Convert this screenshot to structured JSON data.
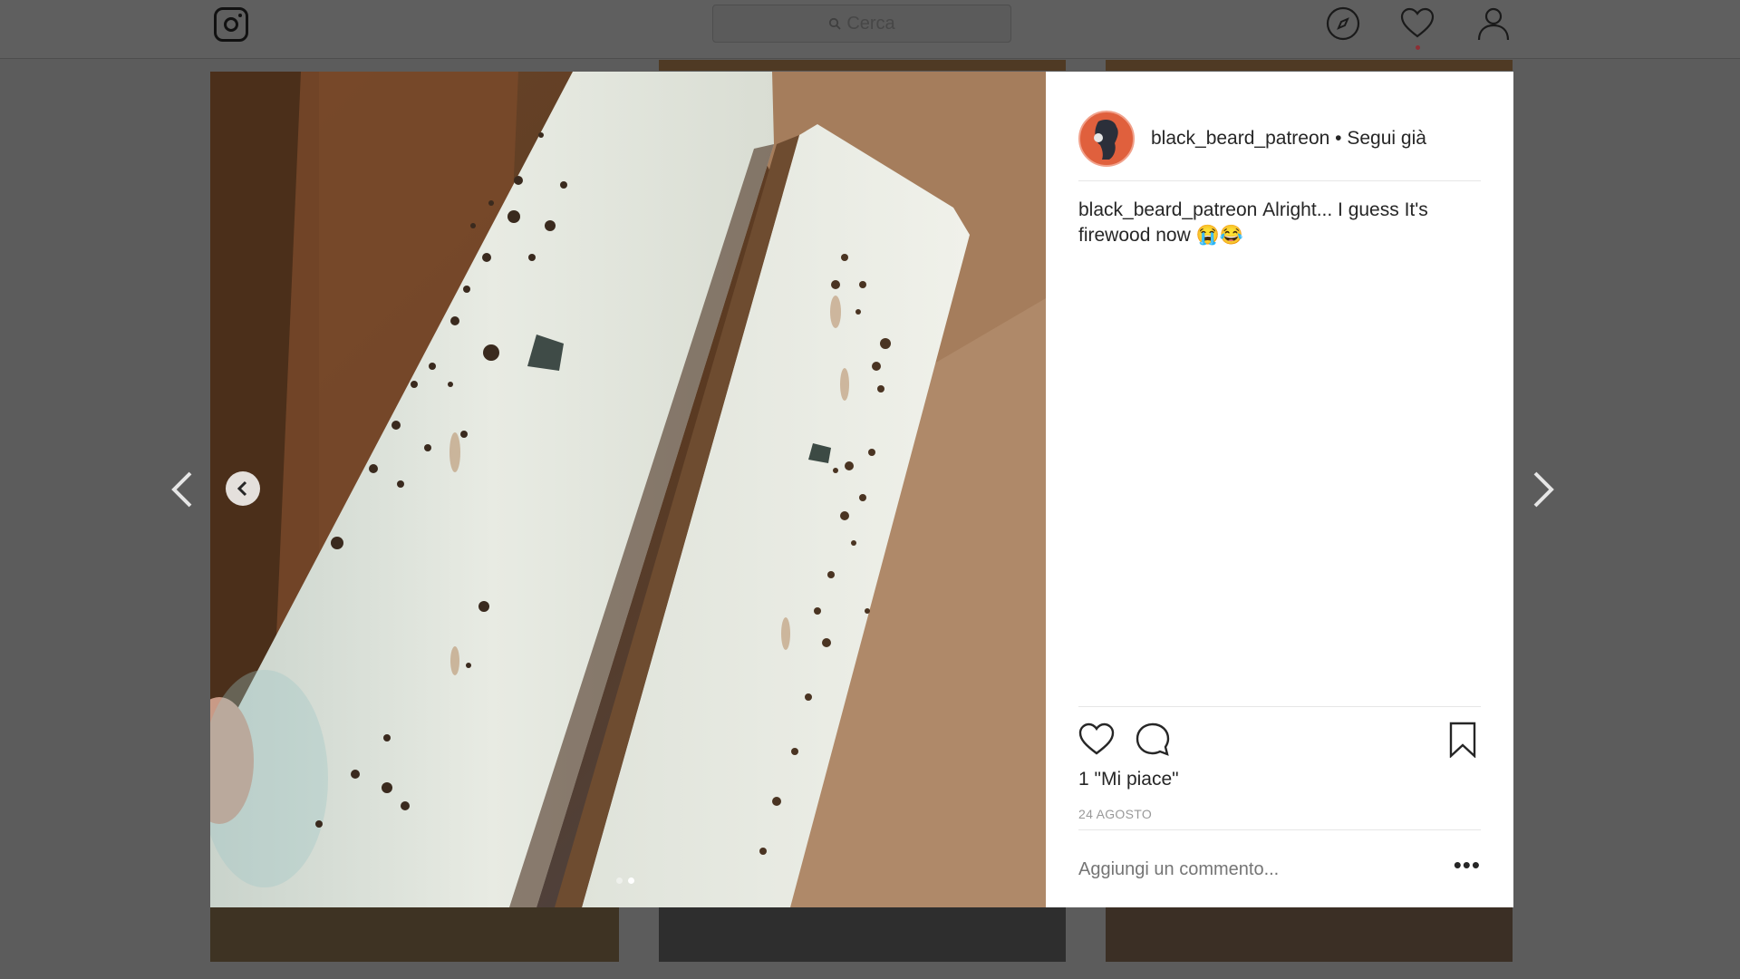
{
  "search": {
    "placeholder": "Cerca"
  },
  "post": {
    "username": "black_beard_patreon",
    "follow_status": "• Segui già",
    "caption_text": "Alright... I guess It's firewood now 😭😂",
    "likes": "1 \"Mi piace\"",
    "date": "24 AGOSTO",
    "comment_placeholder": "Aggiungi un commento...",
    "more": "•••",
    "carousel": {
      "count": 2,
      "active_index": 1
    }
  },
  "icons": {
    "logo": "instagram-icon",
    "explore": "compass-icon",
    "activity": "heart-icon",
    "profile": "user-icon",
    "like": "heart-outline-icon",
    "comment": "comment-icon",
    "save": "bookmark-icon"
  },
  "colors": {
    "brand_avatar": "#e0603d",
    "notification_dot": "#ed4956"
  }
}
